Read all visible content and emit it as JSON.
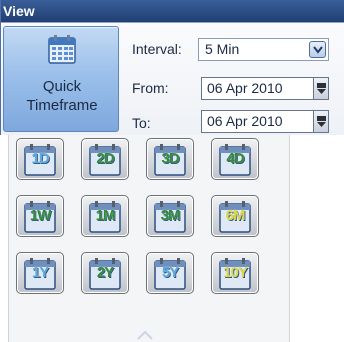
{
  "panel": {
    "title": "View",
    "quick_timeframe": {
      "label_line1": "Quick",
      "label_line2": "Timeframe",
      "icon": "calendar-icon"
    },
    "interval": {
      "label": "Interval:",
      "value": "5 Min"
    },
    "from": {
      "label": "From:",
      "value": "06 Apr 2010"
    },
    "to": {
      "label": "To:",
      "value": "06 Apr 2010"
    }
  },
  "tiles": [
    {
      "text": "1D",
      "style": "blue"
    },
    {
      "text": "2D",
      "style": "green"
    },
    {
      "text": "3D",
      "style": "green"
    },
    {
      "text": "4D",
      "style": "green"
    },
    {
      "text": "1W",
      "style": "green"
    },
    {
      "text": "1M",
      "style": "green"
    },
    {
      "text": "3M",
      "style": "green"
    },
    {
      "text": "6M",
      "style": "yellow"
    },
    {
      "text": "1Y",
      "style": "blue"
    },
    {
      "text": "2Y",
      "style": "green"
    },
    {
      "text": "5Y",
      "style": "blue"
    },
    {
      "text": "10Y",
      "style": "yellow"
    }
  ],
  "colors": {
    "title_bar": "#2a4b82",
    "button_blue": "#9cc0ea",
    "tile_green": "#2f8a3a",
    "tile_blue": "#5aaae0",
    "tile_yellow": "#d8d84a"
  }
}
